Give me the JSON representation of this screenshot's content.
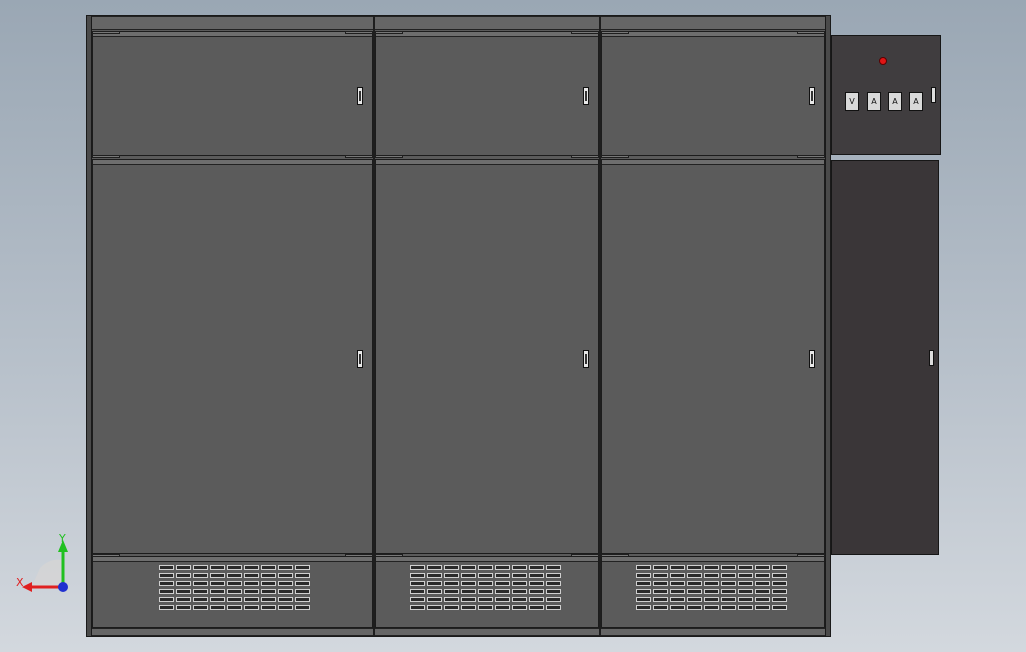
{
  "viewport": {
    "background": [
      "#9aa7b4",
      "#d3d8de"
    ]
  },
  "cabinet": {
    "color": "#5b5b5b",
    "columns": 3,
    "door_rows": [
      "upper-door",
      "main-door",
      "vent-panel"
    ]
  },
  "side_panel": {
    "upper_color": "#403d3f",
    "lower_color": "#3a3638",
    "indicator_color": "#e01515",
    "meters": [
      {
        "label": "V"
      },
      {
        "label": "A"
      },
      {
        "label": "A"
      },
      {
        "label": "A"
      }
    ]
  },
  "triad": {
    "x_label": "X",
    "y_label": "Y",
    "x_color": "#e02020",
    "y_color": "#20c020",
    "z_color": "#2030d0"
  }
}
